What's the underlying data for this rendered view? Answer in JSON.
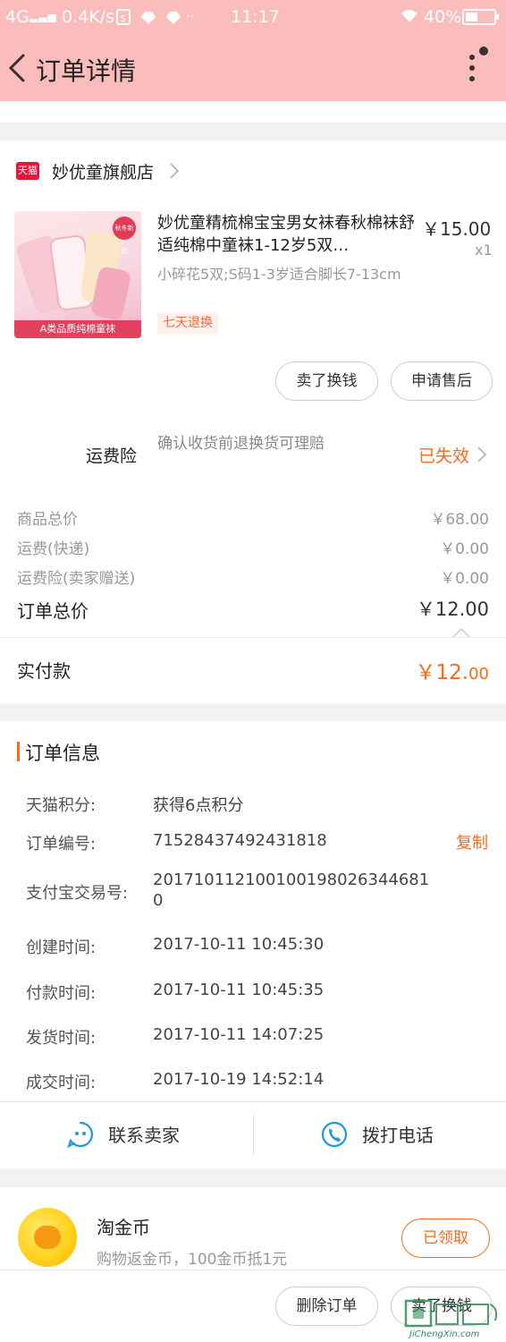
{
  "status_bar": {
    "network": "4G",
    "speed": "0.4K/s",
    "time": "11:17",
    "battery": "40%"
  },
  "header": {
    "title": "订单详情"
  },
  "store": {
    "platform_logo_text": "天猫",
    "name": "妙优童旗舰店"
  },
  "product": {
    "title": "妙优童精梳棉宝宝男女袜春秋棉袜舒适纯棉中童袜1-12岁5双…",
    "price": "￥15.00",
    "quantity": "x1",
    "spec": "小碎花5双;S码1-3岁适合脚长7-13cm",
    "tag": "七天退换",
    "image_banner": "A类品质纯棉童袜",
    "image_badge": "秋冬新款"
  },
  "item_actions": {
    "sell_label": "卖了换钱",
    "after_sale_label": "申请售后"
  },
  "shipping_insurance": {
    "label": "运费险",
    "description": "确认收货前退换货可理赔",
    "status": "已失效"
  },
  "fees": [
    {
      "label": "商品总价",
      "value": "￥68.00"
    },
    {
      "label": "运费(快递)",
      "value": "￥0.00"
    },
    {
      "label": "运费险(卖家赠送)",
      "value": "￥0.00"
    }
  ],
  "order_total": {
    "label": "订单总价",
    "value": "￥12.00"
  },
  "actual_paid": {
    "label": "实付款",
    "value_main": "￥12.",
    "value_cents": "00"
  },
  "order_info": {
    "title": "订单信息",
    "rows": [
      {
        "label": "天猫积分:",
        "value": "获得6点积分"
      },
      {
        "label": "订单编号:",
        "value": "71528437492431818"
      },
      {
        "label": "支付宝交易号:",
        "value": "201710112100100198026344681",
        "value_line2": "0"
      },
      {
        "label": "创建时间:",
        "value": "2017-10-11 10:45:30"
      },
      {
        "label": "付款时间:",
        "value": "2017-10-11 10:45:35"
      },
      {
        "label": "发货时间:",
        "value": "2017-10-11 14:07:25"
      },
      {
        "label": "成交时间:",
        "value": "2017-10-19 14:52:14"
      }
    ],
    "copy_label": "复制"
  },
  "contact": {
    "seller_label": "联系卖家",
    "phone_label": "拨打电话"
  },
  "coins": {
    "title": "淘金币",
    "description": "购物返金币，100金币抵1元",
    "button_label": "已领取"
  },
  "bottom_bar": {
    "delete_label": "删除订单",
    "sell_label": "卖了换钱"
  },
  "watermark": {
    "text": "JiChengXin.com"
  },
  "colors": {
    "header_bg": "#fbbcbc",
    "accent": "#f56a1d",
    "tmall_red": "#e4183b",
    "icon_blue": "#1e9bd7"
  }
}
